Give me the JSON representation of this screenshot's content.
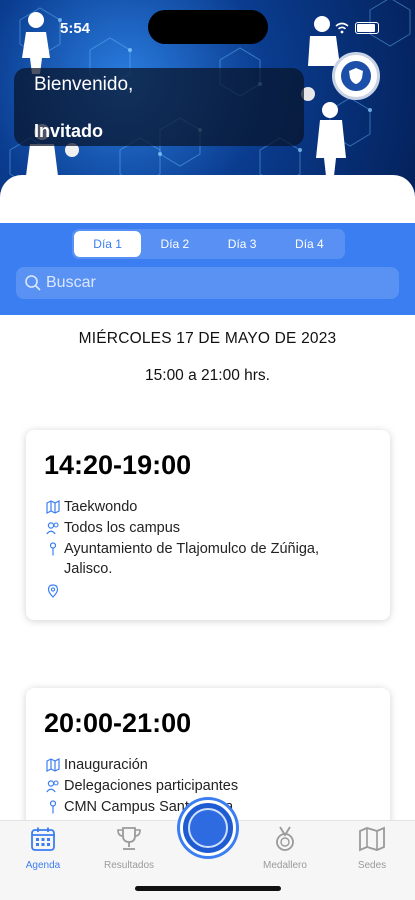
{
  "status_bar": {
    "time": "5:54"
  },
  "header": {
    "greeting": "Bienvenido,",
    "user_name": "Invitado"
  },
  "tabs": [
    {
      "label": "Día 1",
      "active": true
    },
    {
      "label": "Día 2",
      "active": false
    },
    {
      "label": "Día 3",
      "active": false
    },
    {
      "label": "Día 4",
      "active": false
    }
  ],
  "search": {
    "placeholder": "Buscar"
  },
  "schedule": {
    "date": "MIÉRCOLES 17 DE MAYO DE 2023",
    "hours": "15:00 a 21:00 hrs."
  },
  "events": [
    {
      "time": "14:20-19:00",
      "sport": "Taekwondo",
      "participants": "Todos los campus",
      "venue": "Ayuntamiento de Tlajomulco de Zúñiga, Jalisco.",
      "location": ""
    },
    {
      "time": "20:00-21:00",
      "sport": "Inauguración",
      "participants": "Delegaciones participantes",
      "venue": "CMN Campus Santa Anita"
    }
  ],
  "nav": [
    {
      "label": "Agenda",
      "icon": "calendar-icon",
      "active": true
    },
    {
      "label": "Resultados",
      "icon": "trophy-icon",
      "active": false
    },
    {
      "label": "Medallero",
      "icon": "medal-icon",
      "active": false
    },
    {
      "label": "Sedes",
      "icon": "map-icon",
      "active": false
    }
  ],
  "colors": {
    "accent": "#3b7ef2",
    "banner_dark": "#04215a",
    "nav_inactive": "#9a9a9a"
  }
}
